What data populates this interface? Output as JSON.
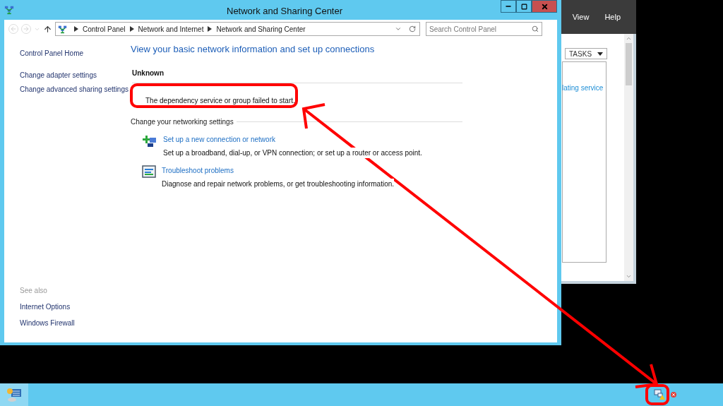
{
  "main_window": {
    "title": "Network and Sharing Center",
    "breadcrumb": [
      "Control Panel",
      "Network and Internet",
      "Network and Sharing Center"
    ],
    "search": {
      "placeholder": "Search Control Panel"
    },
    "sidebar": {
      "links": [
        "Control Panel Home",
        "Change adapter settings",
        "Change advanced sharing settings"
      ],
      "see_also_heading": "See also",
      "see_also": [
        "Internet Options",
        "Windows Firewall"
      ]
    },
    "heading": "View your basic network information and set up connections",
    "network_name": "Unknown",
    "error_message": "The dependency service or group failed to start.",
    "section_title": "Change your networking settings",
    "tasks": [
      {
        "kind": "new-connection",
        "title": "Set up a new connection or network",
        "description": "Set up a broadband, dial-up, or VPN connection; or set up a router or access point."
      },
      {
        "kind": "troubleshoot",
        "title": "Troubleshoot problems",
        "description": "Diagnose and repair network problems, or get troubleshooting information."
      }
    ]
  },
  "background_window": {
    "menu": [
      "View",
      "Help"
    ],
    "tasks_button": "TASKS",
    "link": "lating service"
  }
}
